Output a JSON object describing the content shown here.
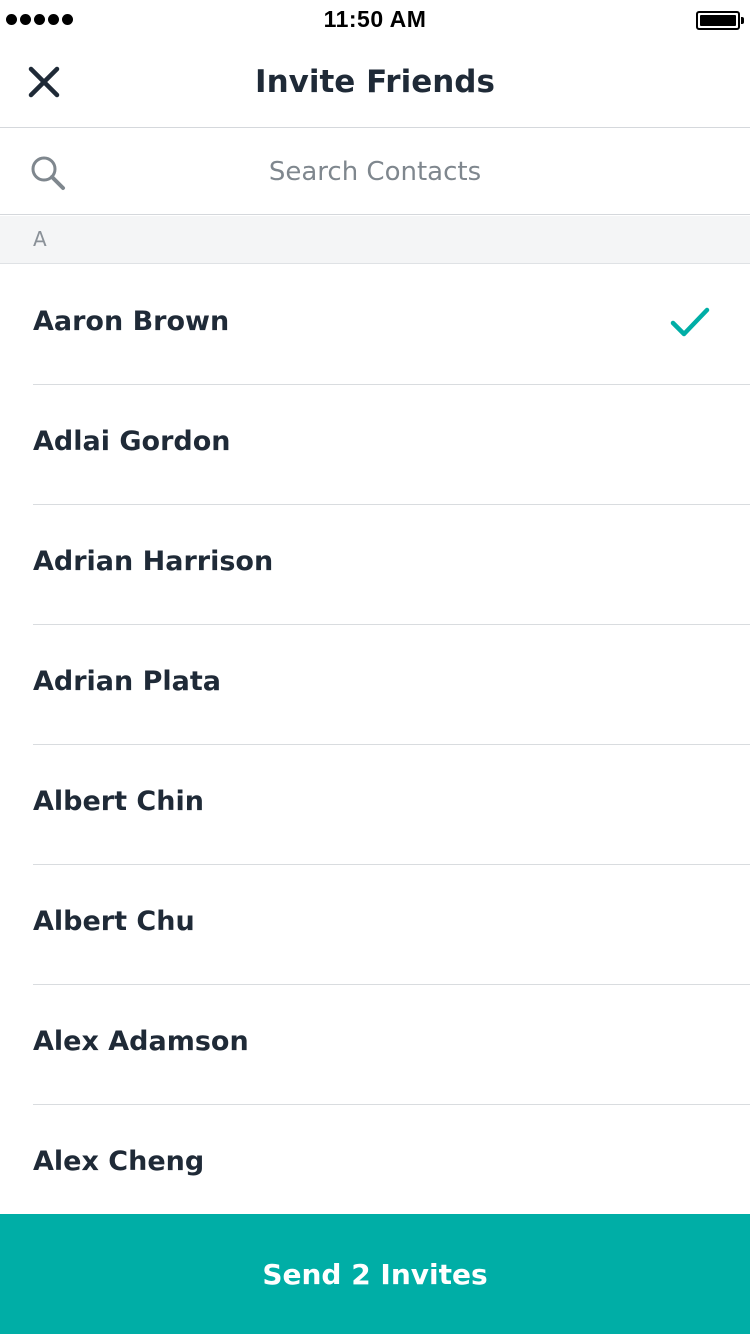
{
  "status_bar": {
    "time": "11:50 AM"
  },
  "nav": {
    "title": "Invite Friends",
    "close_icon": "close-icon"
  },
  "search": {
    "placeholder": "Search Contacts",
    "value": ""
  },
  "section": {
    "letter": "A"
  },
  "contacts": [
    {
      "name": "Aaron Brown",
      "selected": true
    },
    {
      "name": "Adlai Gordon",
      "selected": false
    },
    {
      "name": "Adrian Harrison",
      "selected": false
    },
    {
      "name": "Adrian Plata",
      "selected": false
    },
    {
      "name": "Albert Chin",
      "selected": false
    },
    {
      "name": "Albert Chu",
      "selected": false
    },
    {
      "name": "Alex Adamson",
      "selected": false
    },
    {
      "name": "Alex Cheng",
      "selected": false
    }
  ],
  "send_button": {
    "label": "Send 2 Invites"
  },
  "colors": {
    "accent": "#00aea6",
    "text": "#1f2a37",
    "muted": "#7f878e"
  }
}
